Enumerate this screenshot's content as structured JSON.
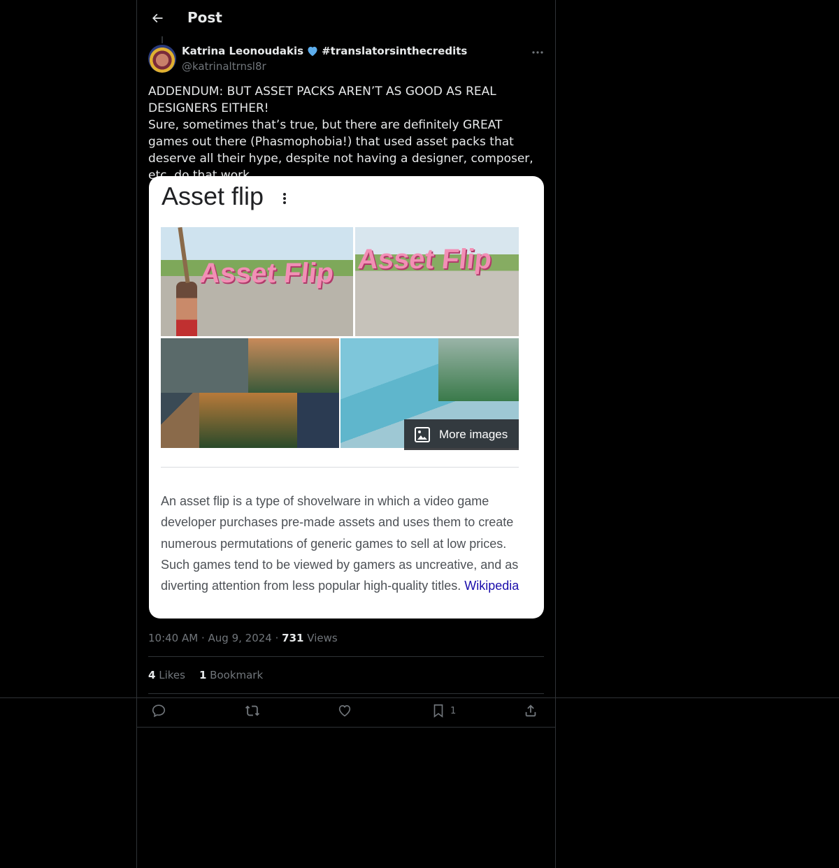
{
  "header": {
    "title": "Post"
  },
  "author": {
    "name": "Katrina Leonoudakis",
    "hashtag": "#translatorsinthecredits",
    "handle": "@katrinaltrnsl8r"
  },
  "post": {
    "text": "ADDENDUM: BUT ASSET PACKS AREN’T AS GOOD AS REAL DESIGNERS EITHER!\nSure, sometimes that’s true, but there are definitely GREAT games out there (Phasmophobia!) that used asset packs that deserve all their hype, despite not having a designer, composer, etc. do that work."
  },
  "card": {
    "title": "Asset flip",
    "image_text_1": "Asset Flip",
    "image_text_2": "Asset Flip",
    "more_images": "More images",
    "description": "An asset flip is a type of shovelware in which a video game developer purchases pre-made assets and uses them to create numerous permutations of generic games to sell at low prices. Such games tend to be viewed by gamers as uncreative, and as diverting attention from less popular high-quality titles. ",
    "source": "Wikipedia"
  },
  "meta": {
    "time": "10:40 AM",
    "date": "Aug 9, 2024",
    "views_count": "731",
    "views_label": "Views"
  },
  "stats": {
    "likes_count": "4",
    "likes_label": "Likes",
    "bookmarks_count": "1",
    "bookmarks_label": "Bookmark"
  },
  "actions": {
    "bookmark_count": "1"
  },
  "icons": {
    "back": "arrow-left-icon",
    "more": "more-horizontal-icon",
    "verified": "blue-heart-icon",
    "reply": "reply-icon",
    "repost": "repost-icon",
    "like": "heart-icon",
    "bookmark": "bookmark-icon",
    "share": "share-icon"
  },
  "colors": {
    "background": "#000000",
    "text": "#e7e9ea",
    "muted": "#71767b",
    "border": "#2f3336",
    "link": "#1a0dab"
  }
}
